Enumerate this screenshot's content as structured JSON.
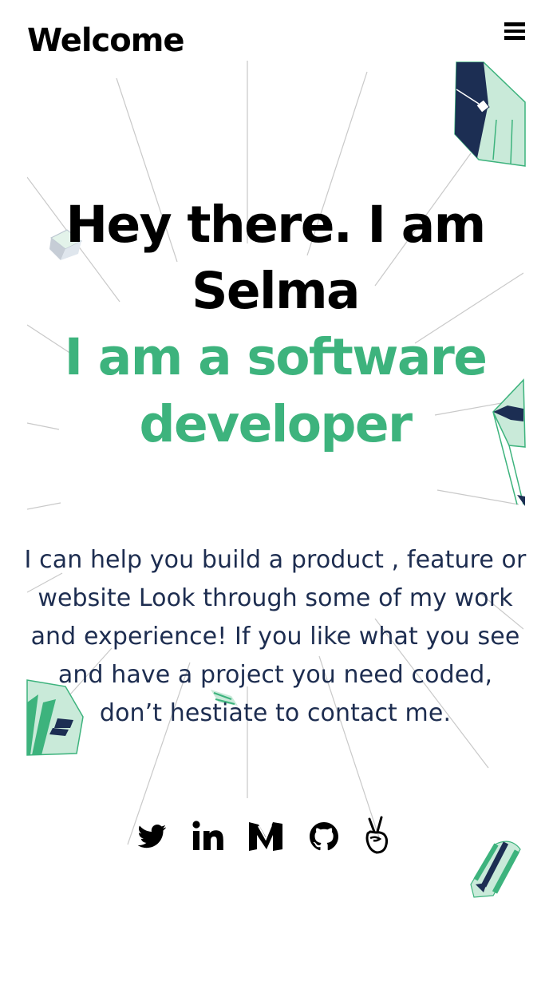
{
  "header": {
    "logo": "Welcome",
    "menu_icon": "hamburger-icon"
  },
  "hero": {
    "title": "Hey there. I am Selma",
    "subtitle": "I am a software developer",
    "accent_color": "#3db37d"
  },
  "intro": {
    "text": "I can help you build a product , feature or website Look through some of my work and experience! If you like what you see and have a project you need coded, don’t hestiate to contact me."
  },
  "social": [
    {
      "icon": "twitter-icon"
    },
    {
      "icon": "linkedin-icon"
    },
    {
      "icon": "medium-icon"
    },
    {
      "icon": "github-icon"
    },
    {
      "icon": "angellist-icon"
    }
  ],
  "colors": {
    "text_dark": "#1d2d50",
    "accent_green": "#3db37d",
    "decor_navy": "#1c2e53",
    "decor_mint": "#c9ead9"
  }
}
